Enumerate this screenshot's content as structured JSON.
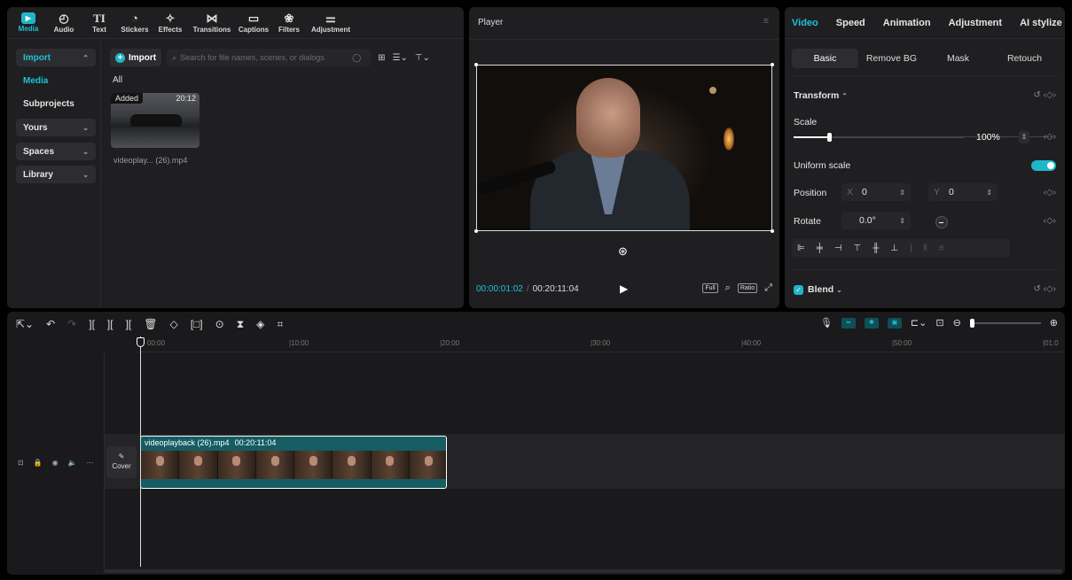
{
  "toolbar": {
    "items": [
      {
        "label": "Media",
        "icon": "media-icon"
      },
      {
        "label": "Audio",
        "icon": "audio-icon"
      },
      {
        "label": "Text",
        "icon": "text-icon"
      },
      {
        "label": "Stickers",
        "icon": "stickers-icon"
      },
      {
        "label": "Effects",
        "icon": "effects-icon"
      },
      {
        "label": "Transitions",
        "icon": "transitions-icon"
      },
      {
        "label": "Captions",
        "icon": "captions-icon"
      },
      {
        "label": "Filters",
        "icon": "filters-icon"
      },
      {
        "label": "Adjustment",
        "icon": "adjustment-icon"
      }
    ]
  },
  "sidebar": {
    "items": [
      {
        "label": "Import"
      },
      {
        "label": "Media"
      },
      {
        "label": "Subprojects"
      },
      {
        "label": "Yours"
      },
      {
        "label": "Spaces"
      },
      {
        "label": "Library"
      }
    ]
  },
  "media": {
    "import_label": "Import",
    "search_placeholder": "Search for file names, scenes, or dialogs",
    "filter_label": "All",
    "items": [
      {
        "badge": "Added",
        "duration": "20:12",
        "name": "videoplay... (26).mp4"
      }
    ]
  },
  "player": {
    "title": "Player",
    "current_time": "00:00:01:02",
    "separator": "/",
    "total_time": "00:20:11:04",
    "full_label": "Full",
    "ratio_label": "Ratio"
  },
  "props": {
    "tabs": [
      "Video",
      "Speed",
      "Animation",
      "Adjustment",
      "AI stylize"
    ],
    "subtabs": [
      "Basic",
      "Remove BG",
      "Mask",
      "Retouch"
    ],
    "transform_label": "Transform",
    "scale_label": "Scale",
    "scale_value": "100%",
    "uniform_scale_label": "Uniform scale",
    "position_label": "Position",
    "x_label": "X",
    "x_value": "0",
    "y_label": "Y",
    "y_value": "0",
    "rotate_label": "Rotate",
    "rotate_value": "0.0°",
    "blend_label": "Blend"
  },
  "timeline": {
    "ruler_labels": [
      "00:00",
      "|10:00",
      "|20:00",
      "|30:00",
      "|40:00",
      "|50:00",
      "|01:0"
    ],
    "cover_label": "Cover",
    "clip_name": "videoplayback (26).mp4",
    "clip_duration": "00:20:11:04"
  }
}
